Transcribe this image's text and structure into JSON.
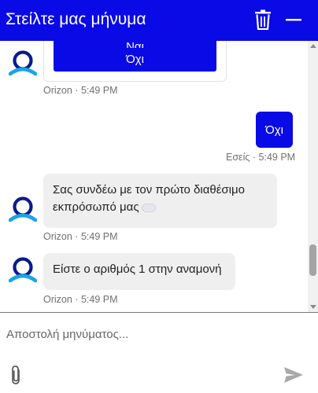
{
  "header": {
    "title": "Στείλτε μας μήνυμα"
  },
  "quick_replies": {
    "yes_label": "Ναι",
    "no_label": "Όχι"
  },
  "messages": [
    {
      "sender": "Orizon",
      "time": "5:49 PM"
    },
    {
      "sender": "Εσείς",
      "time": "5:49 PM",
      "text": "Όχι"
    },
    {
      "sender": "Orizon",
      "time": "5:49 PM",
      "text": "Σας συνδέω με τον πρώτο διαθέσιμο εκπρόσωπό μας"
    },
    {
      "sender": "Orizon",
      "time": "5:49 PM",
      "text": "Είστε ο αριθμός 1 στην αναμονή"
    }
  ],
  "composer": {
    "placeholder": "Αποστολή μηνύματος..."
  },
  "colors": {
    "brand": "#0a0ae6",
    "bubble_bot": "#efefef"
  }
}
